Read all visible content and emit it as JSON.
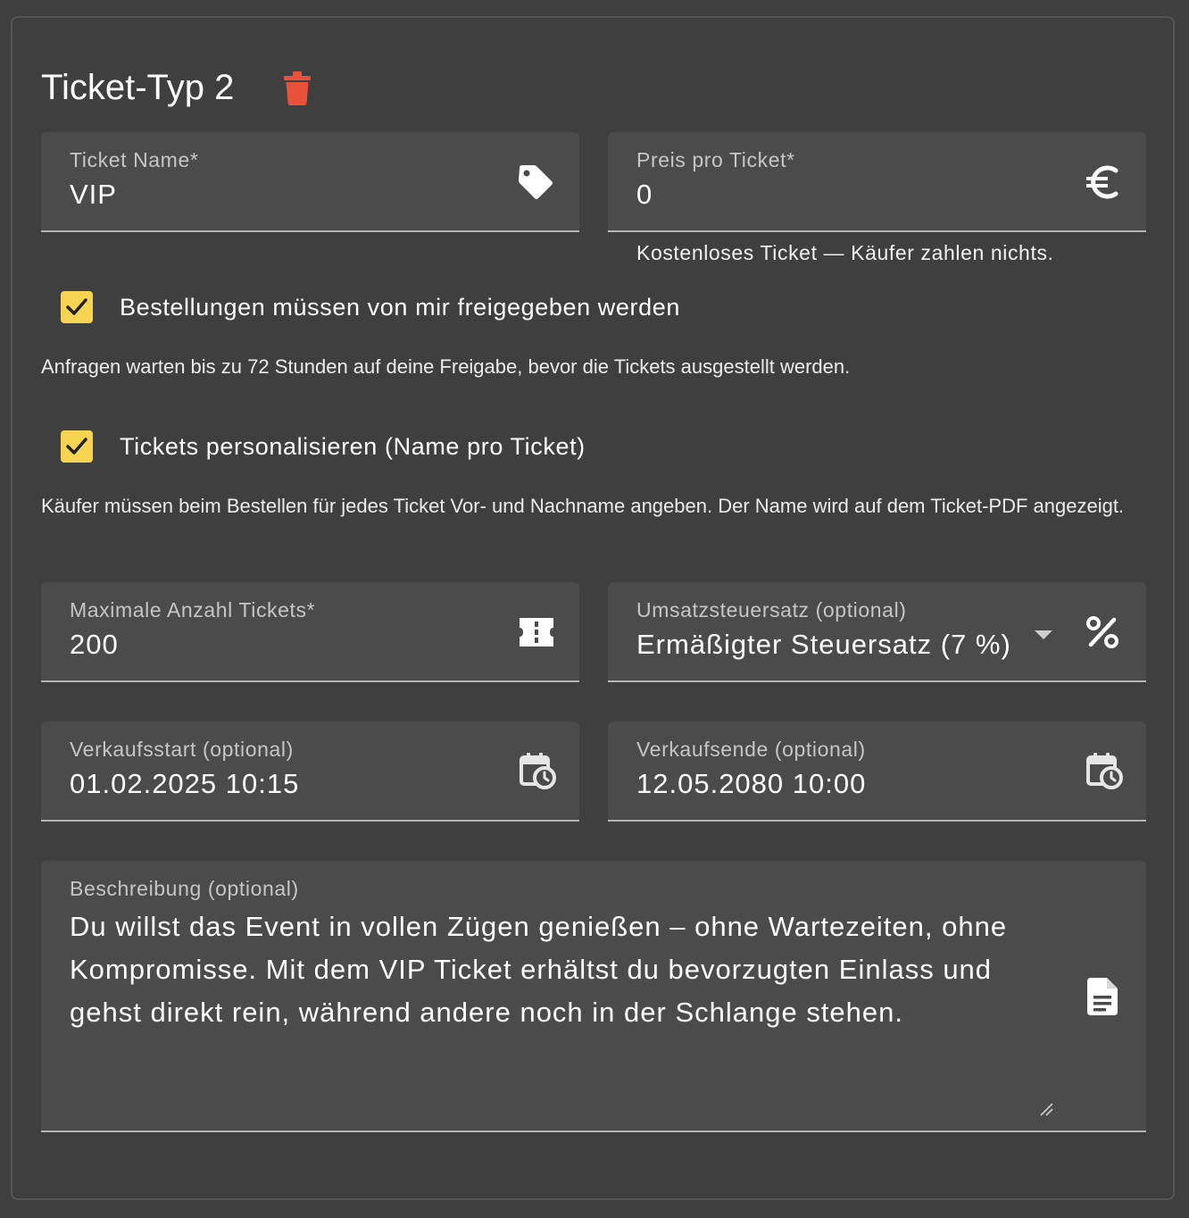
{
  "ticket": {
    "title": "Ticket-Typ 2"
  },
  "fields": {
    "name": {
      "label": "Ticket Name*",
      "value": "VIP"
    },
    "price": {
      "label": "Preis pro Ticket*",
      "value": "0",
      "hint": "Kostenloses Ticket — Käufer zahlen nichts."
    },
    "max_tickets": {
      "label": "Maximale Anzahl Tickets*",
      "value": "200"
    },
    "tax": {
      "label": "Umsatzsteuersatz (optional)",
      "value": "Ermäßigter Steuersatz (7 %)"
    },
    "sale_start": {
      "label": "Verkaufsstart (optional)",
      "value": "01.02.2025 10:15"
    },
    "sale_end": {
      "label": "Verkaufsende (optional)",
      "value": "12.05.2080 10:00"
    },
    "description": {
      "label": "Beschreibung (optional)",
      "value": "Du willst das Event in vollen Zügen genießen – ohne Wartezeiten, ohne Kompromisse. Mit dem VIP Ticket erhältst du bevorzugten Einlass und gehst direkt rein, während andere noch in der Schlange stehen."
    }
  },
  "options": {
    "approval": {
      "label": "Bestellungen müssen von mir freigegeben werden",
      "checked": true,
      "description": "Anfragen warten bis zu 72 Stunden auf deine Freigabe, bevor die Tickets ausgestellt werden."
    },
    "personalize": {
      "label": "Tickets personalisieren (Name pro Ticket)",
      "checked": true,
      "description": "Käufer müssen beim Bestellen für jedes Ticket Vor- und Nachname angeben. Der Name wird auf dem Ticket-PDF angezeigt."
    }
  },
  "icons": {
    "delete": "trash-icon",
    "name": "tag-icon",
    "price": "euro-icon",
    "max_tickets": "ticket-icon",
    "tax": "percent-icon",
    "sale_start": "calendar-clock-icon",
    "sale_end": "calendar-clock-icon",
    "description": "document-icon"
  },
  "colors": {
    "background": "#3f3f3f",
    "field": "#4b4b4b",
    "checkbox": "#f7d451",
    "delete": "#e8523b"
  }
}
